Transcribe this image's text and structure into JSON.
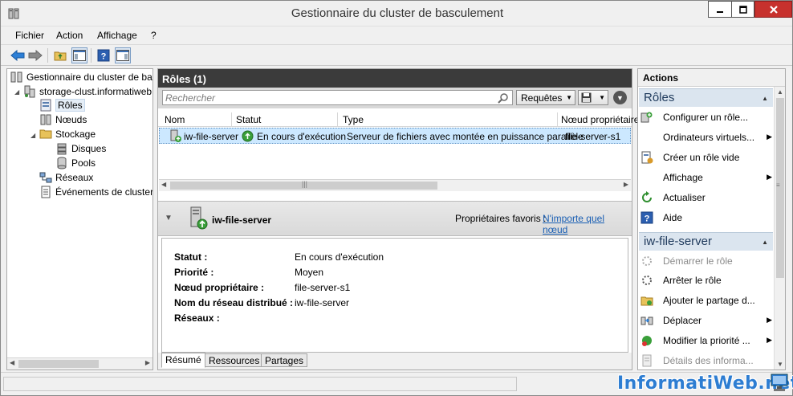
{
  "window": {
    "title": "Gestionnaire du cluster de basculement",
    "controls": [
      "minimize",
      "maximize",
      "close"
    ]
  },
  "menu": {
    "items": [
      "Fichier",
      "Action",
      "Affichage",
      "?"
    ]
  },
  "tree": {
    "items": [
      {
        "label": "Gestionnaire du cluster de basculement",
        "icon": "cluster-manager-icon"
      },
      {
        "label": "storage-clust.informatiweb.lan",
        "icon": "cluster-icon"
      },
      {
        "label": "Rôles",
        "icon": "roles-icon",
        "selected": true
      },
      {
        "label": "Nœuds",
        "icon": "nodes-icon"
      },
      {
        "label": "Stockage",
        "icon": "storage-folder-icon"
      },
      {
        "label": "Disques",
        "icon": "disks-icon"
      },
      {
        "label": "Pools",
        "icon": "pools-icon"
      },
      {
        "label": "Réseaux",
        "icon": "networks-icon"
      },
      {
        "label": "Événements de cluster",
        "icon": "events-icon"
      }
    ]
  },
  "roles": {
    "header": "Rôles (1)",
    "search_placeholder": "Rechercher",
    "requests_label": "Requêtes",
    "columns": [
      "Nom",
      "Statut",
      "Type",
      "Nœud propriétaire"
    ],
    "rows": [
      {
        "name": "iw-file-server",
        "status": "En cours d'exécution",
        "type": "Serveur de fichiers avec montée en puissance parallèle",
        "owner": "file-server-s1"
      }
    ]
  },
  "details": {
    "name": "iw-file-server",
    "preferred_owners_label": "Propriétaires favoris :",
    "preferred_owners_link": "N'importe quel nœud",
    "properties": [
      {
        "label": "Statut :",
        "value": "En cours d'exécution"
      },
      {
        "label": "Priorité :",
        "value": "Moyen"
      },
      {
        "label": "Nœud propriétaire :",
        "value": "file-server-s1"
      },
      {
        "label": "Nom du réseau distribué :",
        "value": "iw-file-server"
      },
      {
        "label": "Réseaux :",
        "value": ""
      }
    ],
    "tabs": [
      "Résumé",
      "Ressources",
      "Partages"
    ]
  },
  "actions": {
    "title": "Actions",
    "section1": {
      "title": "Rôles",
      "items": [
        {
          "label": "Configurer un rôle...",
          "icon": "configure-role-icon",
          "submenu": false,
          "disabled": false
        },
        {
          "label": "Ordinateurs virtuels...",
          "icon": "none",
          "submenu": true,
          "disabled": false
        },
        {
          "label": "Créer un rôle vide",
          "icon": "create-empty-role-icon",
          "submenu": false,
          "disabled": false
        },
        {
          "label": "Affichage",
          "icon": "none",
          "submenu": true,
          "disabled": false
        },
        {
          "label": "Actualiser",
          "icon": "refresh-icon",
          "submenu": false,
          "disabled": false
        },
        {
          "label": "Aide",
          "icon": "help-icon",
          "submenu": false,
          "disabled": false
        }
      ]
    },
    "section2": {
      "title": "iw-file-server",
      "items": [
        {
          "label": "Démarrer le rôle",
          "icon": "start-role-icon",
          "submenu": false,
          "disabled": true
        },
        {
          "label": "Arrêter le rôle",
          "icon": "stop-role-icon",
          "submenu": false,
          "disabled": false
        },
        {
          "label": "Ajouter le partage d...",
          "icon": "add-share-icon",
          "submenu": false,
          "disabled": false
        },
        {
          "label": "Déplacer",
          "icon": "move-icon",
          "submenu": true,
          "disabled": false
        },
        {
          "label": "Modifier la priorité ...",
          "icon": "priority-icon",
          "submenu": true,
          "disabled": false
        },
        {
          "label": "Détails des informa...",
          "icon": "details-icon",
          "submenu": false,
          "disabled": true
        }
      ]
    }
  },
  "watermark": "InformatiWeb.net"
}
